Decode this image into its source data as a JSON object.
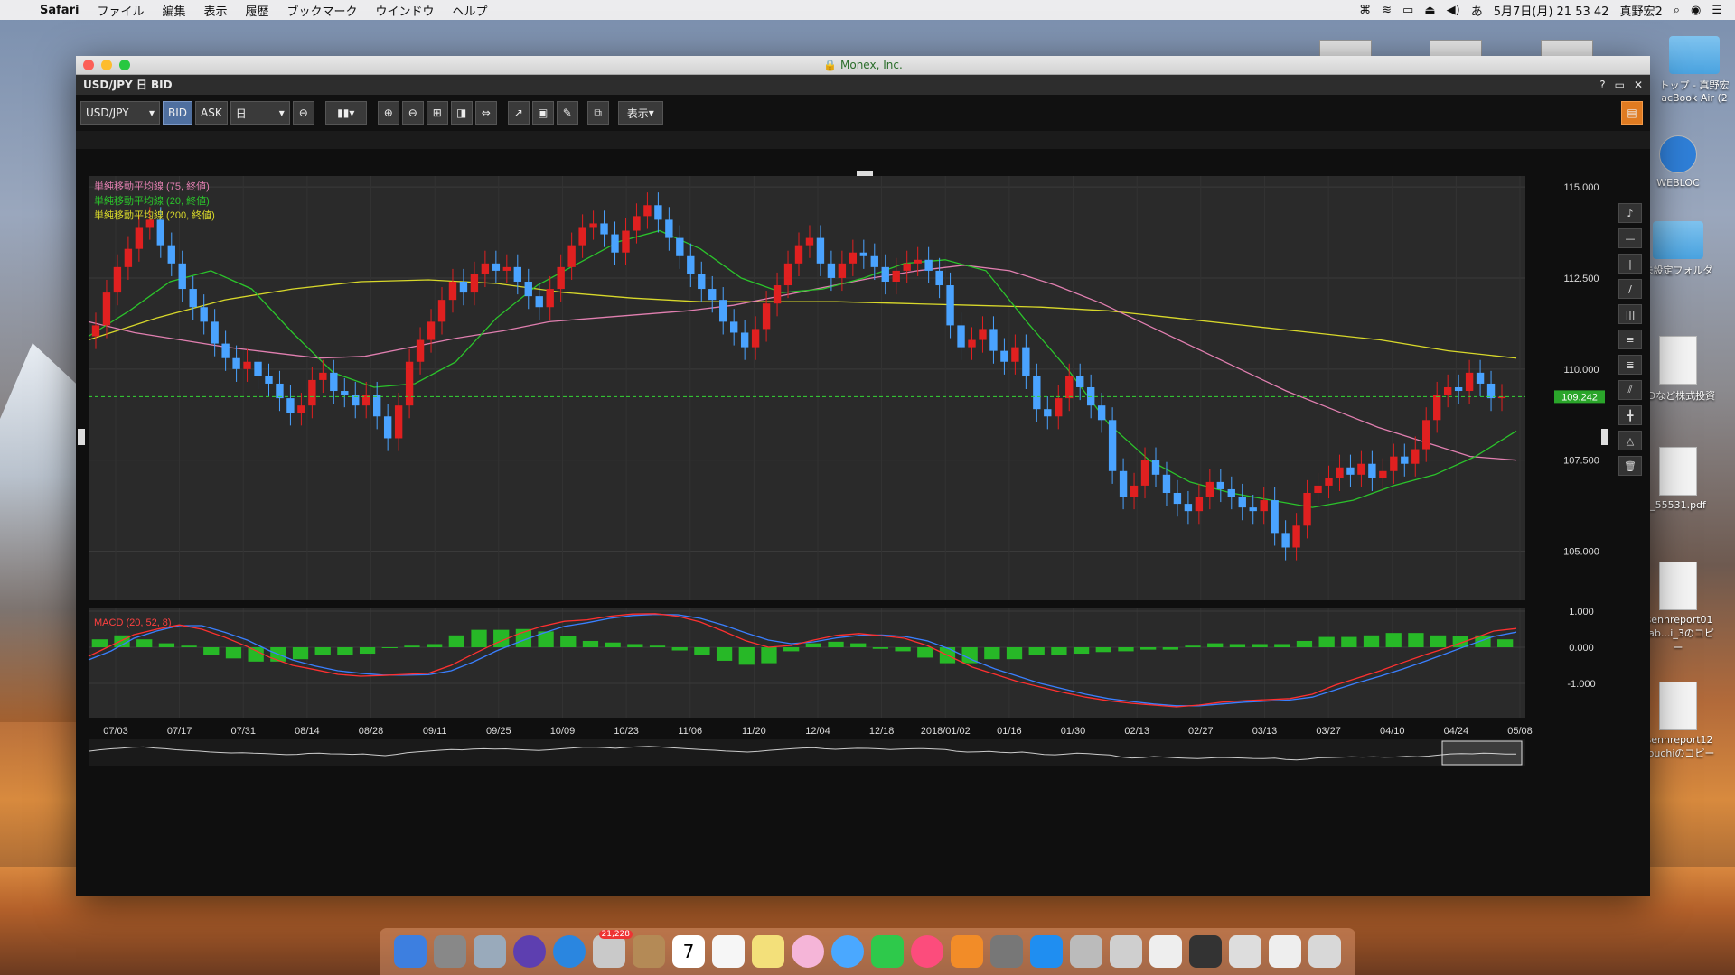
{
  "menubar": {
    "app_name": "Safari",
    "items": [
      "ファイル",
      "編集",
      "表示",
      "履歴",
      "ブックマーク",
      "ウインドウ",
      "ヘルプ"
    ],
    "clock": "5月7日(月) 21 53 42",
    "user": "真野宏2"
  },
  "desktop": {
    "icons": [
      {
        "label": "WEBLOC",
        "sub": ""
      },
      {
        "label": "未設定フォルダ",
        "sub": ""
      },
      {
        "label": "CDなど株式投資",
        "sub": ""
      },
      {
        "label": "_55531.pdf",
        "sub": ""
      },
      {
        "label": "isennreport01",
        "sub": "nab...i_3のコピー"
      },
      {
        "label": "isennreport12",
        "sub": "abuchiのコピー"
      }
    ],
    "partial_labels": [
      "トップ - 真野宏",
      "acBook Air (2"
    ]
  },
  "window": {
    "title": "Monex, Inc.",
    "app_title": "USD/JPY 日 BID",
    "controls": [
      "?",
      "▭",
      "✕"
    ]
  },
  "toolbar": {
    "symbol": "USD/JPY",
    "bid_label": "BID",
    "ask_label": "ASK",
    "period": "日",
    "display_label": "表示"
  },
  "colors": {
    "bull": "#e02020",
    "bear": "#4aa3ff",
    "ma75": "#e17fb0",
    "ma20": "#2bc42b",
    "ma200": "#d8d82a",
    "macd": "#ff3030",
    "signal": "#3a7fff",
    "histogram": "#27b827",
    "price_tag": "#2aa52a"
  },
  "chart_data": {
    "type": "candlestick",
    "legend": [
      {
        "name": "単純移動平均線 (75, 終値)",
        "color": "#e17fb0"
      },
      {
        "name": "単純移動平均線 (20, 終値)",
        "color": "#2bc42b"
      },
      {
        "name": "単純移動平均線 (200, 終値)",
        "color": "#d8d82a"
      }
    ],
    "y_ticks": [
      "115.000",
      "112.500",
      "110.000",
      "107.500",
      "105.000"
    ],
    "y_tick_values": [
      115,
      112.5,
      110,
      107.5,
      105
    ],
    "ylim": [
      103.65,
      115.3
    ],
    "current_price": "109.242",
    "current_price_value": 109.242,
    "x_ticks": [
      "07/03",
      "07/17",
      "07/31",
      "08/14",
      "08/28",
      "09/11",
      "09/25",
      "10/09",
      "10/23",
      "11/06",
      "11/20",
      "12/04",
      "12/18",
      "2018/01/02",
      "01/16",
      "01/30",
      "02/13",
      "02/27",
      "03/13",
      "03/27",
      "04/10",
      "04/24",
      "05/08"
    ],
    "closes": [
      111.2,
      112.1,
      112.8,
      113.3,
      113.9,
      114.1,
      113.4,
      112.9,
      112.2,
      111.7,
      111.3,
      110.7,
      110.3,
      110.0,
      110.2,
      109.8,
      109.6,
      109.2,
      108.8,
      109.0,
      109.7,
      109.9,
      109.4,
      109.3,
      109.0,
      109.3,
      108.7,
      108.1,
      109.0,
      110.2,
      110.8,
      111.3,
      111.9,
      112.4,
      112.1,
      112.6,
      112.9,
      112.7,
      112.8,
      112.4,
      112.0,
      111.7,
      112.2,
      112.8,
      113.4,
      113.9,
      114.0,
      113.7,
      113.2,
      113.8,
      114.2,
      114.5,
      114.1,
      113.6,
      113.1,
      112.6,
      112.2,
      111.9,
      111.3,
      111.0,
      110.6,
      111.1,
      111.8,
      112.3,
      112.9,
      113.4,
      113.6,
      112.9,
      112.5,
      112.9,
      113.2,
      113.1,
      112.8,
      112.4,
      112.7,
      112.9,
      113.0,
      112.7,
      112.3,
      111.2,
      110.6,
      110.8,
      111.1,
      110.5,
      110.2,
      110.6,
      109.8,
      108.9,
      108.7,
      109.2,
      109.8,
      109.5,
      109.0,
      108.6,
      107.2,
      106.5,
      106.8,
      107.5,
      107.1,
      106.6,
      106.3,
      106.1,
      106.5,
      106.9,
      106.7,
      106.5,
      106.2,
      106.1,
      106.4,
      105.5,
      105.1,
      105.7,
      106.6,
      106.8,
      107.0,
      107.3,
      107.1,
      107.4,
      107.0,
      107.2,
      107.6,
      107.4,
      107.8,
      108.6,
      109.3,
      109.5,
      109.4,
      109.9,
      109.6,
      109.2,
      109.24
    ],
    "ma75": [
      111.3,
      111.0,
      110.8,
      110.6,
      110.45,
      110.3,
      110.35,
      110.6,
      110.85,
      111.05,
      111.3,
      111.4,
      111.5,
      111.6,
      111.75,
      112.0,
      112.25,
      112.5,
      112.7,
      112.85,
      112.7,
      112.3,
      111.8,
      111.2,
      110.6,
      110.0,
      109.4,
      108.9,
      108.4,
      108.0,
      107.6,
      107.5
    ],
    "ma20": [
      110.9,
      111.6,
      112.4,
      112.7,
      112.2,
      111.0,
      109.9,
      109.5,
      109.6,
      110.2,
      111.4,
      112.3,
      112.9,
      113.5,
      113.8,
      113.3,
      112.5,
      112.1,
      112.2,
      112.5,
      112.9,
      113.0,
      112.7,
      111.3,
      110.0,
      108.5,
      107.5,
      106.9,
      106.6,
      106.4,
      106.2,
      106.4,
      106.8,
      107.1,
      107.6,
      108.3
    ],
    "ma200": [
      110.8,
      111.4,
      111.9,
      112.2,
      112.4,
      112.45,
      112.35,
      112.1,
      111.95,
      111.85,
      111.85,
      111.85,
      111.8,
      111.75,
      111.7,
      111.6,
      111.4,
      111.2,
      111.0,
      110.8,
      110.5,
      110.3
    ],
    "macd_title": "MACD (20, 52, 8)",
    "macd_y_ticks": [
      "1.000",
      "0.000",
      "-1.000"
    ],
    "macd_y_tick_values": [
      1.0,
      0.0,
      -1.0
    ],
    "macd_ylim": [
      -1.95,
      1.1
    ],
    "macd": [
      -0.25,
      0.05,
      0.35,
      0.5,
      0.62,
      0.5,
      0.28,
      0.02,
      -0.28,
      -0.5,
      -0.62,
      -0.75,
      -0.8,
      -0.78,
      -0.75,
      -0.72,
      -0.5,
      -0.18,
      0.12,
      0.38,
      0.58,
      0.72,
      0.76,
      0.86,
      0.92,
      0.93,
      0.86,
      0.7,
      0.45,
      0.18,
      0.0,
      0.05,
      0.2,
      0.33,
      0.38,
      0.32,
      0.25,
      0.05,
      -0.25,
      -0.55,
      -0.75,
      -0.95,
      -1.1,
      -1.25,
      -1.38,
      -1.48,
      -1.55,
      -1.6,
      -1.65,
      -1.6,
      -1.52,
      -1.48,
      -1.45,
      -1.42,
      -1.3,
      -1.05,
      -0.85,
      -0.65,
      -0.42,
      -0.2,
      0.0,
      0.22,
      0.45,
      0.52
    ],
    "signal": [
      -0.35,
      -0.1,
      0.25,
      0.45,
      0.6,
      0.6,
      0.42,
      0.2,
      -0.1,
      -0.35,
      -0.52,
      -0.65,
      -0.72,
      -0.77,
      -0.77,
      -0.76,
      -0.65,
      -0.4,
      -0.1,
      0.15,
      0.38,
      0.58,
      0.68,
      0.8,
      0.88,
      0.91,
      0.9,
      0.8,
      0.62,
      0.4,
      0.2,
      0.1,
      0.15,
      0.26,
      0.33,
      0.34,
      0.3,
      0.18,
      -0.05,
      -0.35,
      -0.6,
      -0.8,
      -1.0,
      -1.15,
      -1.3,
      -1.42,
      -1.5,
      -1.57,
      -1.62,
      -1.62,
      -1.57,
      -1.52,
      -1.49,
      -1.46,
      -1.38,
      -1.18,
      -0.98,
      -0.8,
      -0.6,
      -0.38,
      -0.15,
      0.08,
      0.3,
      0.42
    ]
  },
  "sidebar_tools": [
    "bell",
    "h-line",
    "v-line",
    "trend-line",
    "channel",
    "fib-1",
    "fib-2",
    "pitchfork",
    "crosshair",
    "triangle",
    "trash"
  ],
  "dock": {
    "badge": "21,228",
    "calendar_day": "7"
  }
}
